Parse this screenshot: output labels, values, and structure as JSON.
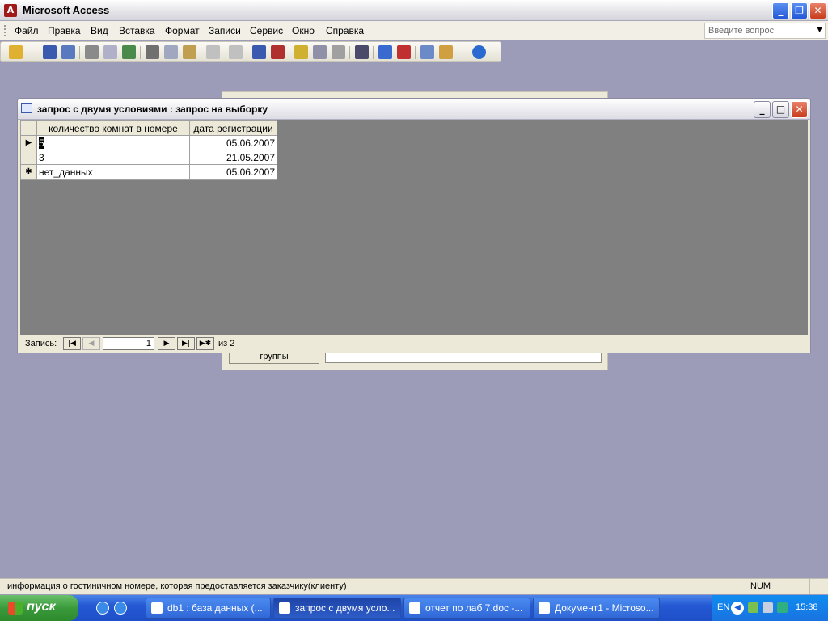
{
  "app": {
    "title": "Microsoft Access",
    "icon_letter": "A"
  },
  "window_buttons": [
    "_",
    "❐",
    "✕"
  ],
  "menu": [
    {
      "label": "Файл"
    },
    {
      "label": "Правка"
    },
    {
      "label": "Вид"
    },
    {
      "label": "Вставка"
    },
    {
      "label": "Формат"
    },
    {
      "label": "Записи"
    },
    {
      "label": "Сервис"
    },
    {
      "label": "Окно"
    },
    {
      "label": "Справка"
    }
  ],
  "help_box": {
    "placeholder": "Введите вопрос"
  },
  "toolbar_icons": [
    "view-icon",
    "save-icon",
    "search-icon",
    "print-icon",
    "print-preview-icon",
    "spelling-icon",
    "cut-icon",
    "copy-icon",
    "paste-icon",
    "undo-icon",
    "hyperlink-icon",
    "sort-ascending-icon",
    "sort-descending-icon",
    "filter-by-selection-icon",
    "filter-by-form-icon",
    "apply-filter-icon",
    "find-icon",
    "new-record-icon",
    "delete-record-icon",
    "database-window-icon",
    "new-object-icon",
    "help-icon"
  ],
  "background_form": {
    "button_label": "группы"
  },
  "query_window": {
    "title": "запрос с двумя условиями : запрос на выборку",
    "columns": [
      "количество комнат в номере",
      "дата регистрации"
    ],
    "rows": [
      {
        "selector": "▶",
        "col1": "5",
        "col2": "05.06.2007"
      },
      {
        "selector": "",
        "col1": "3",
        "col2": "21.05.2007"
      },
      {
        "selector": "✱",
        "col1": "нет_данных",
        "col2": "05.06.2007"
      }
    ],
    "nav": {
      "label": "Запись:",
      "current": "1",
      "of_text": "из 2",
      "first": "|◀",
      "prev": "◀",
      "next": "▶",
      "last": "▶|",
      "new": "▶✱"
    }
  },
  "status": {
    "message": "информация о гостиничном номере, которая предоставляется заказчику(клиенту)",
    "num": "NUM"
  },
  "taskbar": {
    "start_label": "пуск",
    "tasks": [
      {
        "label": "db1 : база данных (..."
      },
      {
        "label": "запрос с двумя усло...",
        "active": true
      },
      {
        "label": "отчет по лаб 7.doc -..."
      },
      {
        "label": "Документ1 - Microso..."
      }
    ],
    "lang": "EN",
    "clock": "15:38"
  }
}
